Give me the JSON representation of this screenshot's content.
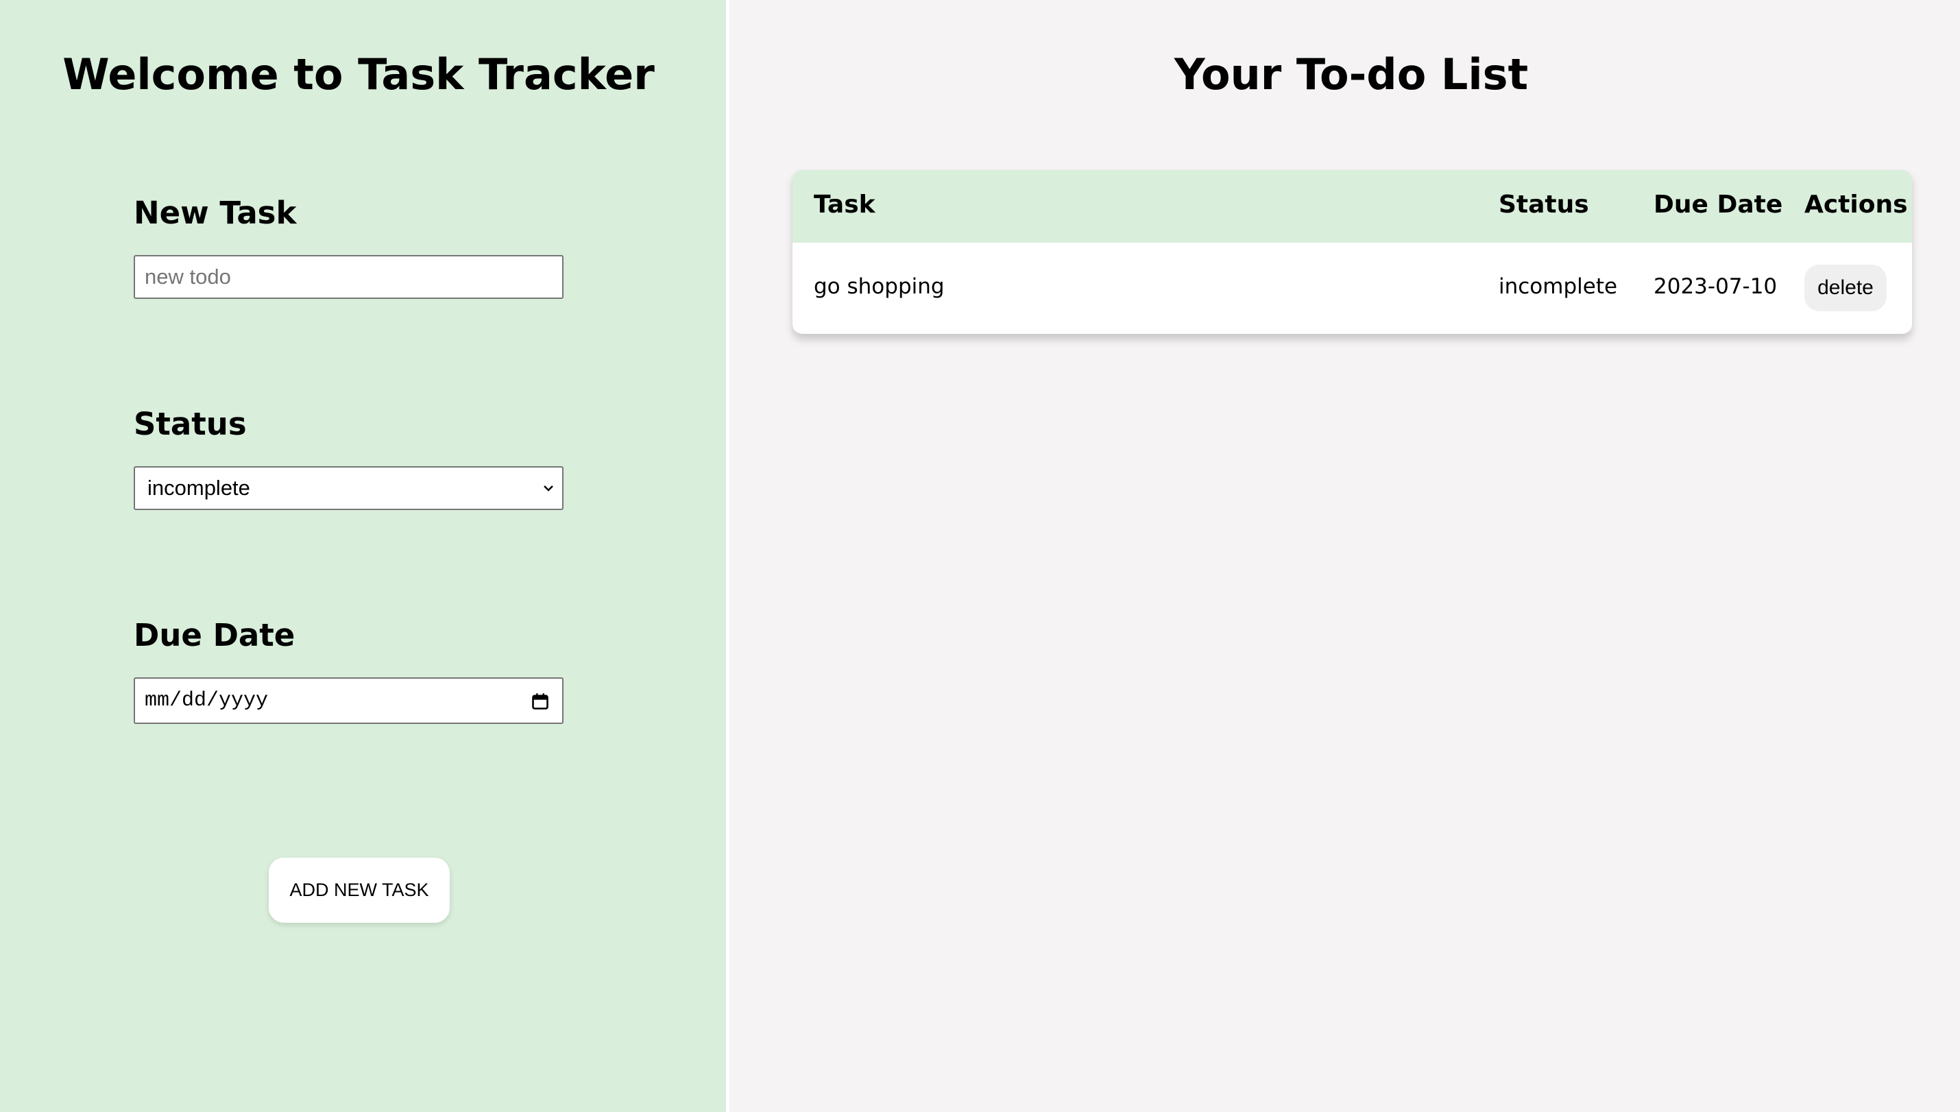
{
  "left": {
    "title": "Welcome to Task Tracker",
    "new_task_label": "New Task",
    "new_task_placeholder": "new todo",
    "status_label": "Status",
    "status_selected": "incomplete",
    "due_date_label": "Due Date",
    "due_date_placeholder": "mm/dd/yyyy",
    "add_button": "ADD NEW TASK"
  },
  "right": {
    "title": "Your To-do List",
    "columns": [
      "Task",
      "Status",
      "Due Date",
      "Actions"
    ],
    "rows": [
      {
        "task": "go shopping",
        "status": "incomplete",
        "due_date": "2023-07-10",
        "action": "delete"
      }
    ]
  },
  "colors": {
    "left_bg": "#d9eedb",
    "right_bg": "#f5f3f4",
    "header_bg": "#d9eedb"
  }
}
